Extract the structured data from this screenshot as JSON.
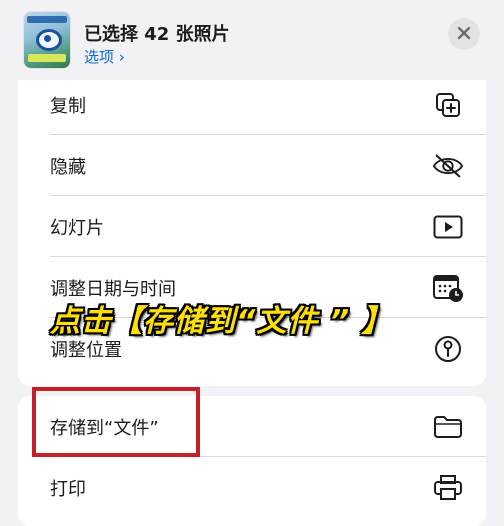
{
  "header": {
    "title": "已选择 42 张照片",
    "options_label": "选项 ›"
  },
  "menu": {
    "group1": [
      {
        "id": "copy",
        "label": "复制",
        "icon": "copy-icon"
      },
      {
        "id": "hide",
        "label": "隐藏",
        "icon": "eye-slash-icon"
      },
      {
        "id": "slideshow",
        "label": "幻灯片",
        "icon": "play-icon"
      },
      {
        "id": "adjust-date",
        "label": "调整日期与时间",
        "icon": "calendar-clock-icon"
      },
      {
        "id": "adjust-location",
        "label": "调整位置",
        "icon": "location-pin-icon"
      }
    ],
    "group2": [
      {
        "id": "save-to-files",
        "label": "存储到“文件”",
        "icon": "folder-icon"
      },
      {
        "id": "print",
        "label": "打印",
        "icon": "printer-icon"
      }
    ]
  },
  "annotation": {
    "callout_text": "点击【存储到“文件 ” 】",
    "highlight_color": "#c4202a",
    "callout_color": "#ffe000"
  },
  "colors": {
    "accent": "#0a6cdd",
    "background": "#f1f1f6"
  }
}
